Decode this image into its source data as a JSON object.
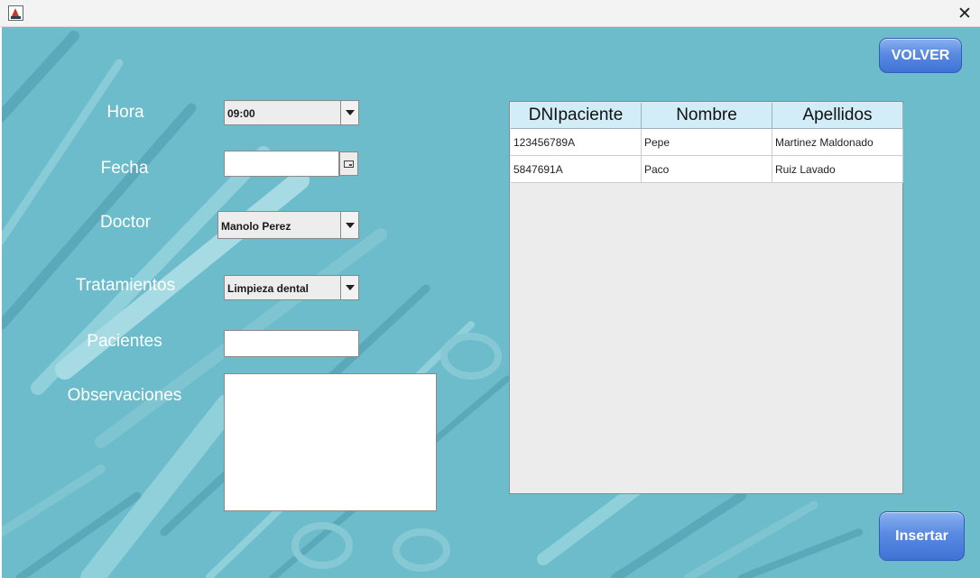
{
  "window": {
    "close_glyph": "✕",
    "app_icon": "java-duke-icon"
  },
  "buttons": {
    "volver": "VOLVER",
    "insertar": "Insertar"
  },
  "form": {
    "hora": {
      "label": "Hora",
      "value": "09:00"
    },
    "fecha": {
      "label": "Fecha",
      "value": ""
    },
    "doctor": {
      "label": "Doctor",
      "value": "Manolo Perez"
    },
    "tratamientos": {
      "label": "Tratamientos",
      "value": "Limpieza dental"
    },
    "pacientes": {
      "label": "Pacientes",
      "value": ""
    },
    "observaciones": {
      "label": "Observaciones",
      "value": ""
    }
  },
  "table": {
    "headers": [
      "DNIpaciente",
      "Nombre",
      "Apellidos"
    ],
    "rows": [
      [
        "123456789A",
        "Pepe",
        "Martinez Maldonado"
      ],
      [
        "5847691A",
        "Paco",
        "Ruiz Lavado"
      ]
    ]
  },
  "colors": {
    "background": "#6cbccc",
    "header": "#d2ecf8",
    "button": "#4f80de"
  }
}
